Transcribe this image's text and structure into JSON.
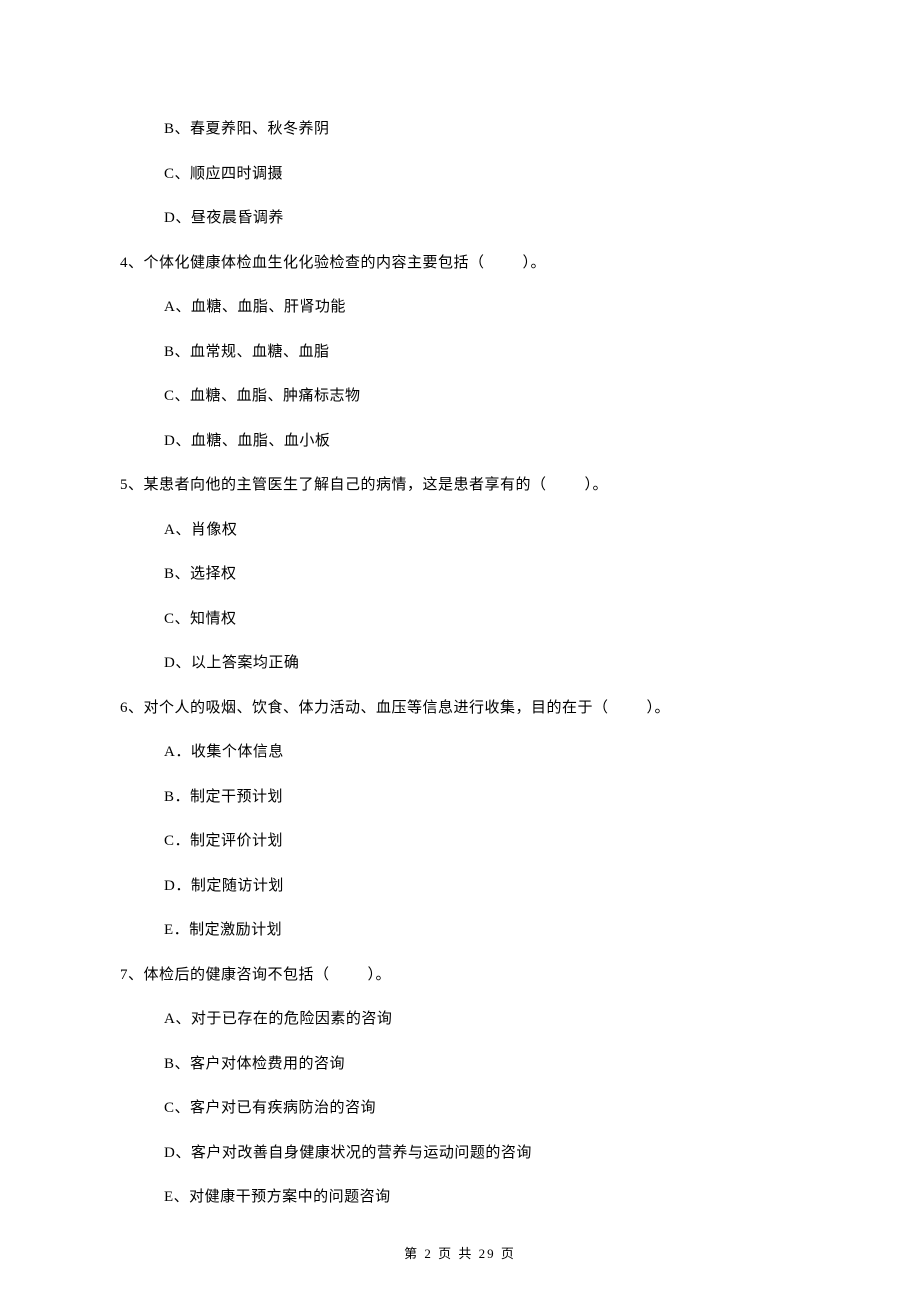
{
  "initial_options": [
    "B、春夏养阳、秋冬养阴",
    "C、顺应四时调摄",
    "D、昼夜晨昏调养"
  ],
  "questions": [
    {
      "stem_prefix": "4、个体化健康体检血生化化验检查的内容主要包括（",
      "blank": "　　",
      "stem_suffix": "）。",
      "options": [
        "A、血糖、血脂、肝肾功能",
        "B、血常规、血糖、血脂",
        "C、血糖、血脂、肿痛标志物",
        "D、血糖、血脂、血小板"
      ]
    },
    {
      "stem_prefix": "5、某患者向他的主管医生了解自己的病情，这是患者享有的（",
      "blank": "　　",
      "stem_suffix": "）。",
      "options": [
        "A、肖像权",
        "B、选择权",
        "C、知情权",
        "D、以上答案均正确"
      ]
    },
    {
      "stem_prefix": "6、对个人的吸烟、饮食、体力活动、血压等信息进行收集，目的在于（",
      "blank": "　　",
      "stem_suffix": "）。",
      "options": [
        "A．收集个体信息",
        "B．制定干预计划",
        "C．制定评价计划",
        "D．制定随访计划",
        "E．制定激励计划"
      ]
    },
    {
      "stem_prefix": "7、体检后的健康咨询不包括（",
      "blank": "　　",
      "stem_suffix": "）。",
      "options": [
        "A、对于已存在的危险因素的咨询",
        "B、客户对体检费用的咨询",
        "C、客户对已有疾病防治的咨询",
        "D、客户对改善自身健康状况的营养与运动问题的咨询",
        "E、对健康干预方案中的问题咨询"
      ]
    }
  ],
  "footer": "第 2 页 共 29 页"
}
